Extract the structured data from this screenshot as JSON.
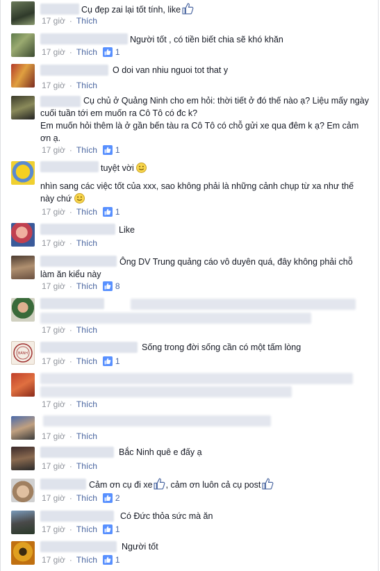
{
  "meta": {
    "time": "17 giờ",
    "like_label": "Thích"
  },
  "comments": [
    {
      "text": "Cụ đẹp zai lại tốt tính, like",
      "likes": null
    },
    {
      "text": "Người tốt , có tiền biết chia sẽ khó khăn",
      "likes": "1"
    },
    {
      "text": "O doi van nhiu nguoi tot that y",
      "likes": null
    },
    {
      "text": "Cụ chủ ở Quảng Ninh cho em hỏi: thời tiết ở đó thế nào ạ? Liệu mấy ngày cuối tuần tới em muốn ra Cô Tô có đc k?",
      "text2": "Em muốn hỏi thêm là ở gần bến tàu ra Cô Tô có chỗ gửi xe qua đêm k ạ? Em cảm ơn ạ.",
      "likes": "1"
    },
    {
      "text": "tuyệt vời",
      "text2": "nhìn sang các việc tốt của xxx, sao không phải là những cảnh chụp từ xa như thế này chứ",
      "likes": "1"
    },
    {
      "text": "Like",
      "likes": null
    },
    {
      "text": "Ông DV Trung quảng cáo vô duyên quá, đây không phải chỗ làm ăn kiểu này",
      "likes": "8"
    },
    {
      "text": "",
      "likes": null
    },
    {
      "text": "Sống trong đời sống cần có một tấm lòng",
      "likes": "1"
    },
    {
      "text": "",
      "likes": null
    },
    {
      "text": "",
      "likes": null
    },
    {
      "text": "Bắc Ninh quê e đấy ạ",
      "likes": null
    },
    {
      "text": "Cảm ơn cụ đi xe",
      "text2": ", cảm ơn luôn cả cụ post",
      "likes": "2"
    },
    {
      "text": "Có Đức thỏa sức mà ăn",
      "likes": "1"
    },
    {
      "text": "Người tốt",
      "likes": "1"
    }
  ],
  "seal_text": "BÁNH"
}
